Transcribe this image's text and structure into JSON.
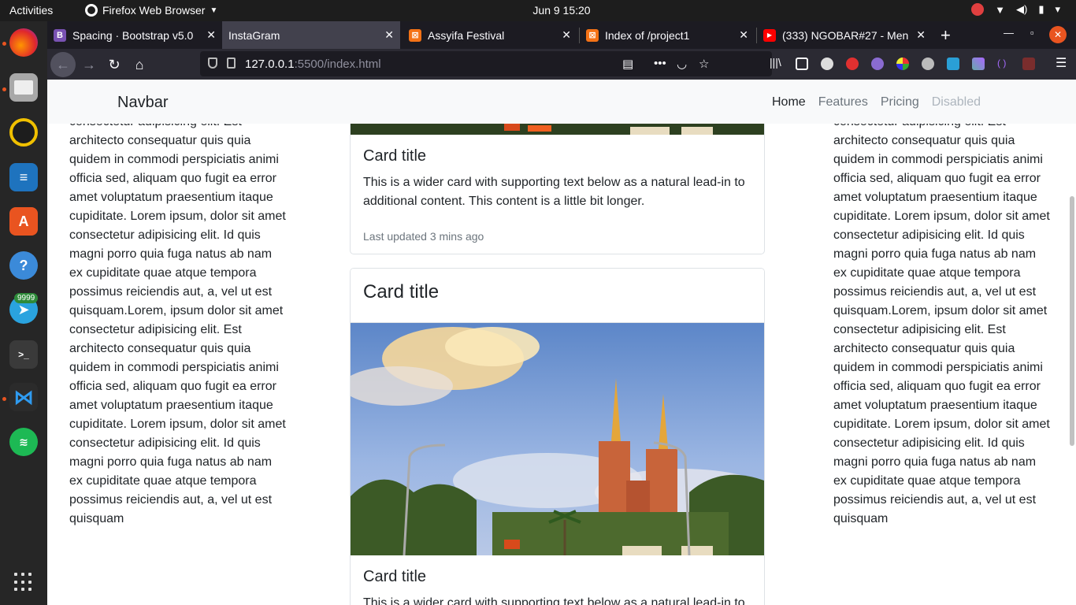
{
  "topbar": {
    "activities": "Activities",
    "app_name": "Firefox Web Browser",
    "clock": "Jun 9  15:20"
  },
  "dock": {
    "telegram_badge": "9999",
    "items": [
      "firefox-icon",
      "files-icon",
      "rhythmbox-icon",
      "writer-icon",
      "software-icon",
      "help-icon",
      "telegram-icon",
      "terminal-icon",
      "vscode-icon",
      "spotify-icon"
    ]
  },
  "browser": {
    "tabs": [
      {
        "title": "Spacing · Bootstrap v5.0",
        "favicon": "B",
        "color": "#7952b3"
      },
      {
        "title": "InstaGram",
        "favicon": "",
        "color": ""
      },
      {
        "title": "Assyifa Festival",
        "favicon": "⊠",
        "color": "#f47216"
      },
      {
        "title": "Index of /project1",
        "favicon": "⊠",
        "color": "#f47216"
      },
      {
        "title": "(333) NGOBAR#27 - Men",
        "favicon": "▶",
        "color": "#ff0000"
      }
    ],
    "url_host": "127.0.0.1",
    "url_rest": ":5500/index.html"
  },
  "page": {
    "navbar": {
      "brand": "Navbar",
      "links": [
        "Home",
        "Features",
        "Pricing",
        "Disabled"
      ]
    },
    "left_text": "consectetur adipisicing elit. Est architecto consequatur quis quia quidem in commodi perspiciatis animi officia sed, aliquam quo fugit ea error amet voluptatum praesentium itaque cupiditate. Lorem ipsum, dolor sit amet consectetur adipisicing elit. Id quis magni porro quia fuga natus ab nam ex cupiditate quae atque tempora possimus reiciendis aut, a, vel ut est quisquam.Lorem, ipsum dolor sit amet consectetur adipisicing elit. Est architecto consequatur quis quia quidem in commodi perspiciatis animi officia sed, aliquam quo fugit ea error amet voluptatum praesentium itaque cupiditate. Lorem ipsum, dolor sit amet consectetur adipisicing elit. Id quis magni porro quia fuga natus ab nam ex cupiditate quae atque tempora possimus reiciendis aut, a, vel ut est quisquam",
    "right_text": "consectetur adipisicing elit. Est architecto consequatur quis quia quidem in commodi perspiciatis animi officia sed, aliquam quo fugit ea error amet voluptatum praesentium itaque cupiditate. Lorem ipsum, dolor sit amet consectetur adipisicing elit. Id quis magni porro quia fuga natus ab nam ex cupiditate quae atque tempora possimus reiciendis aut, a, vel ut est quisquam.Lorem, ipsum dolor sit amet consectetur adipisicing elit. Est architecto consequatur quis quia quidem in commodi perspiciatis animi officia sed, aliquam quo fugit ea error amet voluptatum praesentium itaque cupiditate. Lorem ipsum, dolor sit amet consectetur adipisicing elit. Id quis magni porro quia fuga natus ab nam ex cupiditate quae atque tempora possimus reiciendis aut, a, vel ut est quisquam",
    "card1": {
      "title": "Card title",
      "text": "This is a wider card with supporting text below as a natural lead-in to additional content. This content is a little bit longer.",
      "updated": "Last updated 3 mins ago"
    },
    "card2": {
      "header": "Card title",
      "title": "Card title",
      "text": "This is a wider card with supporting text below as a natural lead-in to additional content."
    }
  }
}
